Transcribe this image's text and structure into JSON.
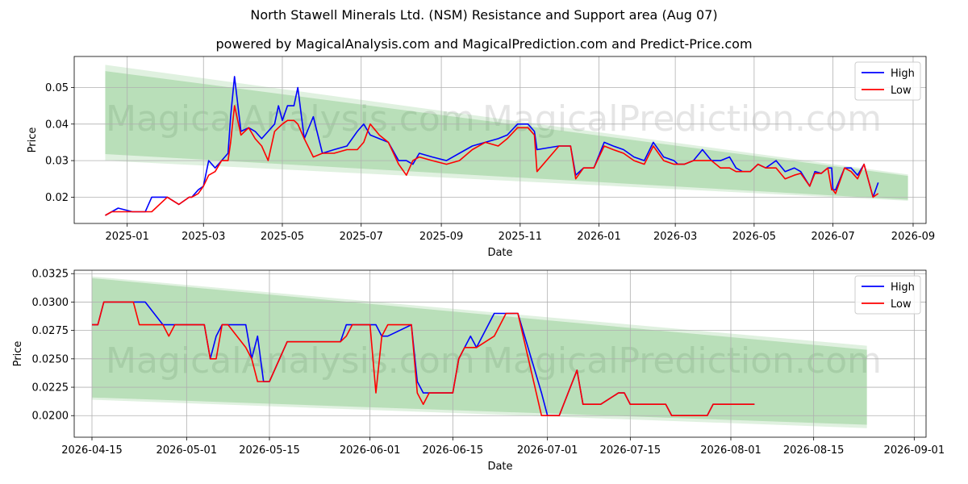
{
  "title": "North Stawell Minerals Ltd. (NSM) Resistance and Support area (Aug 07)",
  "subtitle": "powered by MagicalAnalysis.com and MagicalPrediction.com and Predict-Price.com",
  "watermark": [
    "MagicalAnalysis.com",
    "MagicalPrediction.com"
  ],
  "colors": {
    "high": "#0000ff",
    "low": "#ff0000",
    "band": "#2ca02c",
    "grid": "#b0b0b0"
  },
  "chart_data": [
    {
      "type": "line",
      "xlabel": "Date",
      "ylabel": "Price",
      "x_ticks": [
        "2025-01",
        "2025-03",
        "2025-05",
        "2025-07",
        "2025-09",
        "2025-11",
        "2026-01",
        "2026-03",
        "2026-05",
        "2026-07",
        "2026-09"
      ],
      "y_ticks": [
        "0.02",
        "0.03",
        "0.04",
        "0.05"
      ],
      "xlim": [
        "2024-11-21",
        "2026-09-11"
      ],
      "ylim": [
        0.0128,
        0.0585
      ],
      "legend": "top-right",
      "grid": true,
      "band_outer": {
        "x": [
          "2024-12-15",
          "2026-08-28"
        ],
        "upper": [
          0.0562,
          0.0262
        ],
        "lower": [
          0.03,
          0.019
        ]
      },
      "band_inner": {
        "x": [
          "2024-12-15",
          "2026-08-28"
        ],
        "upper": [
          0.0545,
          0.0258
        ],
        "lower": [
          0.0318,
          0.0193
        ]
      },
      "series": [
        {
          "name": "High",
          "x": [
            "2024-12-15",
            "2024-12-20",
            "2024-12-25",
            "2025-01-05",
            "2025-01-15",
            "2025-01-20",
            "2025-02-01",
            "2025-02-10",
            "2025-02-18",
            "2025-02-20",
            "2025-02-25",
            "2025-03-01",
            "2025-03-05",
            "2025-03-10",
            "2025-03-15",
            "2025-03-20",
            "2025-03-22",
            "2025-03-25",
            "2025-03-30",
            "2025-04-05",
            "2025-04-10",
            "2025-04-15",
            "2025-04-20",
            "2025-04-25",
            "2025-04-28",
            "2025-05-01",
            "2025-05-05",
            "2025-05-10",
            "2025-05-13",
            "2025-05-18",
            "2025-05-25",
            "2025-06-01",
            "2025-06-10",
            "2025-06-20",
            "2025-06-28",
            "2025-07-03",
            "2025-07-08",
            "2025-07-15",
            "2025-07-22",
            "2025-07-30",
            "2025-08-05",
            "2025-08-10",
            "2025-08-15",
            "2025-08-25",
            "2025-09-05",
            "2025-09-15",
            "2025-09-25",
            "2025-10-05",
            "2025-10-15",
            "2025-10-22",
            "2025-10-30",
            "2025-11-07",
            "2025-11-12",
            "2025-11-14",
            "2025-12-01",
            "2025-12-10",
            "2025-12-14",
            "2025-12-20",
            "2025-12-28",
            "2026-01-05",
            "2026-01-12",
            "2026-01-20",
            "2026-01-28",
            "2026-02-05",
            "2026-02-12",
            "2026-02-20",
            "2026-02-28",
            "2026-03-03",
            "2026-03-08",
            "2026-03-15",
            "2026-03-22",
            "2026-03-29",
            "2026-04-05",
            "2026-04-12",
            "2026-04-17",
            "2026-04-22",
            "2026-04-28",
            "2026-05-04",
            "2026-05-10",
            "2026-05-18",
            "2026-05-25",
            "2026-06-01",
            "2026-06-06",
            "2026-06-13",
            "2026-06-17",
            "2026-06-22",
            "2026-06-27",
            "2026-06-30",
            "2026-07-01",
            "2026-07-03",
            "2026-07-10",
            "2026-07-15",
            "2026-07-20",
            "2026-07-25",
            "2026-08-01",
            "2026-08-05"
          ],
          "values": [
            0.015,
            0.016,
            0.017,
            0.016,
            0.016,
            0.02,
            0.02,
            0.018,
            0.02,
            0.02,
            0.022,
            0.023,
            0.03,
            0.028,
            0.03,
            0.032,
            0.042,
            0.053,
            0.038,
            0.039,
            0.038,
            0.036,
            0.038,
            0.04,
            0.045,
            0.041,
            0.045,
            0.045,
            0.05,
            0.036,
            0.042,
            0.032,
            0.033,
            0.034,
            0.038,
            0.04,
            0.037,
            0.036,
            0.035,
            0.03,
            0.03,
            0.029,
            0.032,
            0.031,
            0.03,
            0.032,
            0.034,
            0.035,
            0.036,
            0.037,
            0.04,
            0.04,
            0.038,
            0.033,
            0.034,
            0.034,
            0.026,
            0.028,
            0.028,
            0.035,
            0.034,
            0.033,
            0.031,
            0.03,
            0.035,
            0.031,
            0.03,
            0.029,
            0.029,
            0.03,
            0.033,
            0.03,
            0.03,
            0.031,
            0.028,
            0.027,
            0.027,
            0.029,
            0.028,
            0.03,
            0.027,
            0.028,
            0.027,
            0.023,
            0.027,
            0.0265,
            0.028,
            0.028,
            0.022,
            0.022,
            0.028,
            0.028,
            0.026,
            0.029,
            0.02,
            0.024
          ]
        },
        {
          "name": "Low",
          "x": [
            "2024-12-15",
            "2024-12-20",
            "2024-12-25",
            "2025-01-05",
            "2025-01-15",
            "2025-01-20",
            "2025-02-01",
            "2025-02-10",
            "2025-02-18",
            "2025-02-20",
            "2025-02-25",
            "2025-03-01",
            "2025-03-05",
            "2025-03-10",
            "2025-03-15",
            "2025-03-20",
            "2025-03-22",
            "2025-03-25",
            "2025-03-30",
            "2025-04-05",
            "2025-04-10",
            "2025-04-15",
            "2025-04-20",
            "2025-04-25",
            "2025-04-28",
            "2025-05-01",
            "2025-05-05",
            "2025-05-10",
            "2025-05-13",
            "2025-05-18",
            "2025-05-25",
            "2025-06-01",
            "2025-06-10",
            "2025-06-20",
            "2025-06-28",
            "2025-07-03",
            "2025-07-08",
            "2025-07-15",
            "2025-07-22",
            "2025-07-30",
            "2025-08-05",
            "2025-08-10",
            "2025-08-15",
            "2025-08-25",
            "2025-09-05",
            "2025-09-15",
            "2025-09-25",
            "2025-10-05",
            "2025-10-15",
            "2025-10-22",
            "2025-10-30",
            "2025-11-07",
            "2025-11-12",
            "2025-11-14",
            "2025-12-01",
            "2025-12-10",
            "2025-12-14",
            "2025-12-20",
            "2025-12-28",
            "2026-01-05",
            "2026-01-12",
            "2026-01-20",
            "2026-01-28",
            "2026-02-05",
            "2026-02-12",
            "2026-02-20",
            "2026-02-28",
            "2026-03-03",
            "2026-03-08",
            "2026-03-15",
            "2026-03-22",
            "2026-03-29",
            "2026-04-05",
            "2026-04-12",
            "2026-04-17",
            "2026-04-22",
            "2026-04-28",
            "2026-05-04",
            "2026-05-10",
            "2026-05-18",
            "2026-05-25",
            "2026-06-01",
            "2026-06-06",
            "2026-06-13",
            "2026-06-17",
            "2026-06-22",
            "2026-06-27",
            "2026-06-30",
            "2026-07-01",
            "2026-07-03",
            "2026-07-10",
            "2026-07-15",
            "2026-07-20",
            "2026-07-25",
            "2026-08-01",
            "2026-08-05"
          ],
          "values": [
            0.015,
            0.016,
            0.016,
            0.016,
            0.016,
            0.016,
            0.02,
            0.018,
            0.02,
            0.02,
            0.021,
            0.023,
            0.026,
            0.027,
            0.03,
            0.03,
            0.035,
            0.045,
            0.037,
            0.039,
            0.036,
            0.034,
            0.03,
            0.038,
            0.039,
            0.04,
            0.041,
            0.041,
            0.04,
            0.036,
            0.031,
            0.032,
            0.032,
            0.033,
            0.033,
            0.035,
            0.04,
            0.037,
            0.035,
            0.029,
            0.026,
            0.03,
            0.031,
            0.03,
            0.029,
            0.03,
            0.033,
            0.035,
            0.034,
            0.036,
            0.039,
            0.039,
            0.037,
            0.027,
            0.034,
            0.034,
            0.025,
            0.028,
            0.028,
            0.034,
            0.033,
            0.032,
            0.03,
            0.029,
            0.034,
            0.03,
            0.029,
            0.029,
            0.029,
            0.03,
            0.03,
            0.03,
            0.028,
            0.028,
            0.027,
            0.027,
            0.027,
            0.029,
            0.028,
            0.028,
            0.025,
            0.026,
            0.0265,
            0.023,
            0.0265,
            0.0265,
            0.028,
            0.022,
            0.022,
            0.021,
            0.028,
            0.027,
            0.025,
            0.029,
            0.02,
            0.021
          ]
        }
      ]
    },
    {
      "type": "line",
      "xlabel": "Date",
      "ylabel": "Price",
      "x_ticks": [
        "2026-04-15",
        "2026-05-01",
        "2026-05-15",
        "2026-06-01",
        "2026-06-15",
        "2026-07-01",
        "2026-07-15",
        "2026-08-01",
        "2026-08-15",
        "2026-09-01"
      ],
      "y_ticks": [
        "0.0200",
        "0.0225",
        "0.0250",
        "0.0275",
        "0.0300",
        "0.0325"
      ],
      "xlim": [
        "2026-04-12",
        "2026-09-03"
      ],
      "ylim": [
        0.0181,
        0.0328
      ],
      "legend": "top-right",
      "grid": true,
      "band_outer": {
        "x": [
          "2026-04-15",
          "2026-08-24"
        ],
        "upper": [
          0.03225,
          0.02615
        ],
        "lower": [
          0.0214,
          0.0189
        ]
      },
      "band_inner": {
        "x": [
          "2026-04-15",
          "2026-08-24"
        ],
        "upper": [
          0.0321,
          0.0258
        ],
        "lower": [
          0.0216,
          0.0192
        ]
      },
      "series": [
        {
          "name": "High",
          "x": [
            "2026-04-15",
            "2026-04-16",
            "2026-04-17",
            "2026-04-19",
            "2026-04-21",
            "2026-04-22",
            "2026-04-23",
            "2026-04-24",
            "2026-04-27",
            "2026-04-28",
            "2026-04-29",
            "2026-05-01",
            "2026-05-04",
            "2026-05-05",
            "2026-05-06",
            "2026-05-07",
            "2026-05-08",
            "2026-05-11",
            "2026-05-12",
            "2026-05-13",
            "2026-05-14",
            "2026-05-15",
            "2026-05-18",
            "2026-05-19",
            "2026-05-20",
            "2026-05-27",
            "2026-05-28",
            "2026-05-29",
            "2026-06-01",
            "2026-06-02",
            "2026-06-03",
            "2026-06-04",
            "2026-06-08",
            "2026-06-09",
            "2026-06-10",
            "2026-06-11",
            "2026-06-12",
            "2026-06-15",
            "2026-06-16",
            "2026-06-17",
            "2026-06-18",
            "2026-06-19",
            "2026-06-22",
            "2026-06-24",
            "2026-06-25",
            "2026-06-26",
            "2026-06-30",
            "2026-07-01",
            "2026-07-02",
            "2026-07-03",
            "2026-07-06",
            "2026-07-07",
            "2026-07-08",
            "2026-07-09",
            "2026-07-10",
            "2026-07-13",
            "2026-07-14",
            "2026-07-15",
            "2026-07-16",
            "2026-07-17",
            "2026-07-20",
            "2026-07-21",
            "2026-07-22",
            "2026-07-23",
            "2026-07-24",
            "2026-07-27",
            "2026-07-28",
            "2026-07-29",
            "2026-07-30",
            "2026-07-31",
            "2026-08-05"
          ],
          "values": [
            0.028,
            0.028,
            0.03,
            0.03,
            0.03,
            0.03,
            0.03,
            0.03,
            0.028,
            0.028,
            0.028,
            0.028,
            0.028,
            0.025,
            0.027,
            0.028,
            0.028,
            0.028,
            0.025,
            0.027,
            0.023,
            0.023,
            0.0265,
            0.0265,
            0.0265,
            0.0265,
            0.028,
            0.028,
            0.028,
            0.028,
            0.027,
            0.027,
            0.028,
            0.023,
            0.022,
            0.022,
            0.022,
            0.022,
            0.025,
            0.026,
            0.027,
            0.026,
            0.029,
            0.029,
            0.029,
            0.029,
            0.022,
            0.02,
            0.02,
            0.02,
            0.024,
            0.021,
            0.021,
            0.021,
            0.021,
            0.022,
            0.022,
            0.021,
            0.021,
            0.021,
            0.021,
            0.021,
            0.02,
            0.02,
            0.02,
            0.02,
            0.02,
            0.021,
            0.021,
            0.021,
            0.021
          ]
        },
        {
          "name": "Low",
          "x": [
            "2026-04-15",
            "2026-04-16",
            "2026-04-17",
            "2026-04-19",
            "2026-04-21",
            "2026-04-22",
            "2026-04-23",
            "2026-04-24",
            "2026-04-27",
            "2026-04-28",
            "2026-04-29",
            "2026-05-01",
            "2026-05-04",
            "2026-05-05",
            "2026-05-06",
            "2026-05-07",
            "2026-05-08",
            "2026-05-11",
            "2026-05-12",
            "2026-05-13",
            "2026-05-14",
            "2026-05-15",
            "2026-05-18",
            "2026-05-19",
            "2026-05-20",
            "2026-05-27",
            "2026-05-28",
            "2026-05-29",
            "2026-06-01",
            "2026-06-02",
            "2026-06-03",
            "2026-06-04",
            "2026-06-08",
            "2026-06-09",
            "2026-06-10",
            "2026-06-11",
            "2026-06-12",
            "2026-06-15",
            "2026-06-16",
            "2026-06-17",
            "2026-06-18",
            "2026-06-19",
            "2026-06-22",
            "2026-06-24",
            "2026-06-25",
            "2026-06-26",
            "2026-06-30",
            "2026-07-01",
            "2026-07-02",
            "2026-07-03",
            "2026-07-06",
            "2026-07-07",
            "2026-07-08",
            "2026-07-09",
            "2026-07-10",
            "2026-07-13",
            "2026-07-14",
            "2026-07-15",
            "2026-07-16",
            "2026-07-17",
            "2026-07-20",
            "2026-07-21",
            "2026-07-22",
            "2026-07-23",
            "2026-07-24",
            "2026-07-27",
            "2026-07-28",
            "2026-07-29",
            "2026-07-30",
            "2026-07-31",
            "2026-08-05"
          ],
          "values": [
            0.028,
            0.028,
            0.03,
            0.03,
            0.03,
            0.03,
            0.028,
            0.028,
            0.028,
            0.027,
            0.028,
            0.028,
            0.028,
            0.025,
            0.025,
            0.028,
            0.028,
            0.026,
            0.025,
            0.023,
            0.023,
            0.023,
            0.0265,
            0.0265,
            0.0265,
            0.0265,
            0.027,
            0.028,
            0.028,
            0.022,
            0.027,
            0.028,
            0.028,
            0.022,
            0.021,
            0.022,
            0.022,
            0.022,
            0.025,
            0.026,
            0.026,
            0.026,
            0.027,
            0.029,
            0.029,
            0.029,
            0.02,
            0.02,
            0.02,
            0.02,
            0.024,
            0.021,
            0.021,
            0.021,
            0.021,
            0.022,
            0.022,
            0.021,
            0.021,
            0.021,
            0.021,
            0.021,
            0.02,
            0.02,
            0.02,
            0.02,
            0.02,
            0.021,
            0.021,
            0.021,
            0.021
          ]
        }
      ]
    }
  ]
}
